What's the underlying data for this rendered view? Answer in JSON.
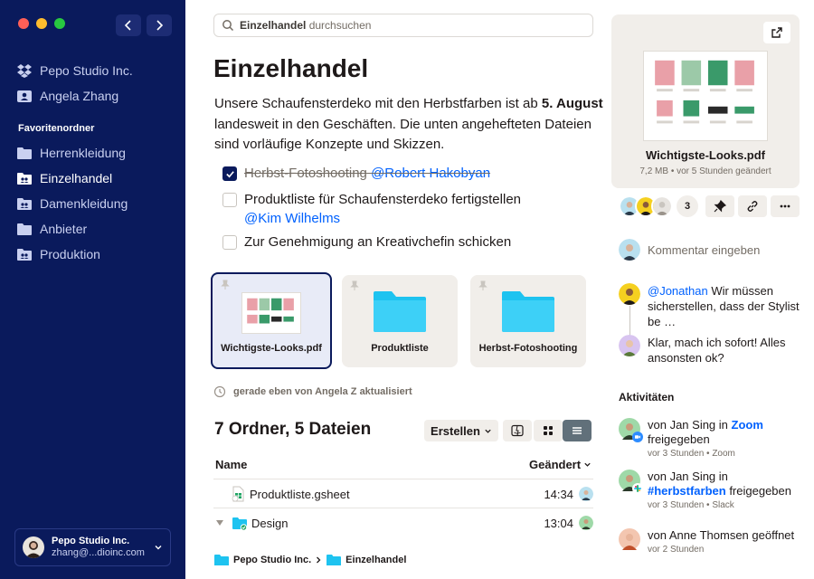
{
  "sidebar": {
    "accounts": [
      "Pepo Studio Inc.",
      "Angela Zhang"
    ],
    "section_label": "Favoritenordner",
    "items": [
      {
        "label": "Herrenkleidung",
        "icon": "folder-icon",
        "active": false
      },
      {
        "label": "Einzelhandel",
        "icon": "shared-folder-icon",
        "active": true
      },
      {
        "label": "Damenkleidung",
        "icon": "shared-folder-icon",
        "active": false
      },
      {
        "label": "Anbieter",
        "icon": "folder-icon",
        "active": false
      },
      {
        "label": "Produktion",
        "icon": "shared-folder-icon",
        "active": false
      }
    ],
    "account_switcher": {
      "name": "Pepo Studio Inc.",
      "email": "zhang@...dioinc.com"
    }
  },
  "search": {
    "query": "Einzelhandel",
    "suffix": "durchsuchen"
  },
  "main": {
    "title": "Einzelhandel",
    "intro": {
      "part1": "Unsere Schaufensterdeko mit den Herbstfarben ist ab ",
      "date": "5. August",
      "part2": " landesweit in den Geschäften. Die unten angehefteten Dateien sind vorläufige Konzepte und Skizzen."
    },
    "tasks": [
      {
        "text": "Herbst-Fotoshooting",
        "mention": "@Robert Hakobyan",
        "checked": true
      },
      {
        "text": "Produktliste für Schaufensterdeko fertigstellen",
        "mention": "@Kim Wilhelms",
        "checked": false
      },
      {
        "text": "Zur Genehmigung an Kreativchefin schicken",
        "mention": "",
        "checked": false
      }
    ],
    "pinned": [
      {
        "label": "Wichtigste-Looks.pdf",
        "type": "pdf"
      },
      {
        "label": "Produktliste",
        "type": "folder"
      },
      {
        "label": "Herbst-Fotoshooting",
        "type": "folder"
      }
    ],
    "updated_text": "gerade eben von Angela Z aktualisiert",
    "count": "7 Ordner, 5 Dateien",
    "create_label": "Erstellen",
    "columns": {
      "name": "Name",
      "modified": "Geändert"
    },
    "files": [
      {
        "name": "Produktliste.gsheet",
        "time": "14:34",
        "icon": "gsheet-icon"
      },
      {
        "name": "Design",
        "time": "13:04",
        "icon": "folder-icon"
      }
    ],
    "breadcrumb": [
      "Pepo Studio Inc.",
      "Einzelhandel"
    ]
  },
  "preview": {
    "name": "Wichtigste-Looks.pdf",
    "meta": "7,2 MB • vor 5 Stunden geändert",
    "viewer_count": "3"
  },
  "comments": {
    "placeholder": "Kommentar eingeben",
    "items": [
      {
        "mention": "@Jonathan",
        "text": " Wir müssen sicherstellen, dass der Stylist be …"
      },
      {
        "mention": "",
        "text": "Klar, mach ich sofort! Alles ansonsten ok?"
      }
    ]
  },
  "activities": {
    "title": "Aktivitäten",
    "items": [
      {
        "prefix": "von Jan Sing in ",
        "link": "Zoom",
        "suffix": " freigegeben",
        "meta": "vor 3 Stunden • Zoom"
      },
      {
        "prefix": "von Jan Sing in ",
        "link": "#herbstfarben",
        "suffix": " freigegeben",
        "meta": "vor 3 Stunden • Slack"
      },
      {
        "prefix": "von Anne Thomsen geöffnet",
        "link": "",
        "suffix": "",
        "meta": "vor 2 Stunden"
      }
    ]
  },
  "colors": {
    "sidebar": "#0a1a5c",
    "accent": "#0061fe",
    "folder": "#1ec3f0"
  }
}
